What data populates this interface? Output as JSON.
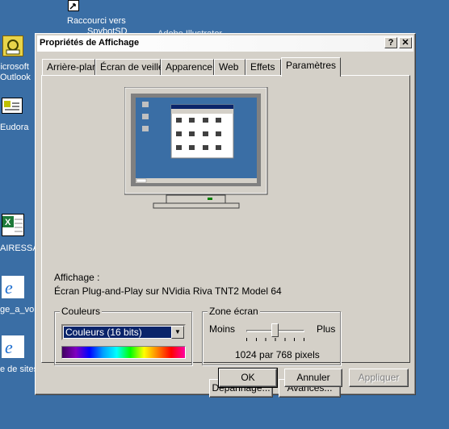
{
  "desktop": {
    "shortcut_label_line1": "Raccourci vers",
    "shortcut_label_line2": "SpybotSD",
    "behind_title": "Adobe Illustrator",
    "icons": [
      {
        "label_line1": "licrosoft",
        "label_line2": "Outlook"
      },
      {
        "label_line1": "Eudora"
      },
      {
        "label_line1": "AIRESSA"
      },
      {
        "label_line1": "ge_a_voir"
      },
      {
        "label_line1": "e de sites"
      }
    ]
  },
  "dialog": {
    "title": "Propriétés de Affichage",
    "help_btn": "?",
    "close_btn": "✕",
    "tabs": [
      "Arrière-plan",
      "Écran de veille",
      "Apparence",
      "Web",
      "Effets",
      "Paramètres"
    ],
    "active_tab": "Paramètres",
    "display_label": "Affichage :",
    "display_value": "Écran Plug-and-Play sur NVidia Riva TNT2 Model 64",
    "colors": {
      "legend": "Couleurs",
      "selected": "Couleurs (16 bits)"
    },
    "screen_area": {
      "legend": "Zone écran",
      "less": "Moins",
      "more": "Plus",
      "value": "1024 par 768 pixels",
      "slider_level": 0.5
    },
    "buttons": {
      "troubleshoot": "Dépannage...",
      "advanced": "Avancés...",
      "ok": "OK",
      "cancel": "Annuler",
      "apply": "Appliquer"
    }
  },
  "colors": {
    "desktop": "#3a6ea5",
    "face": "#d4d0c8",
    "highlight": "#0a246a"
  }
}
